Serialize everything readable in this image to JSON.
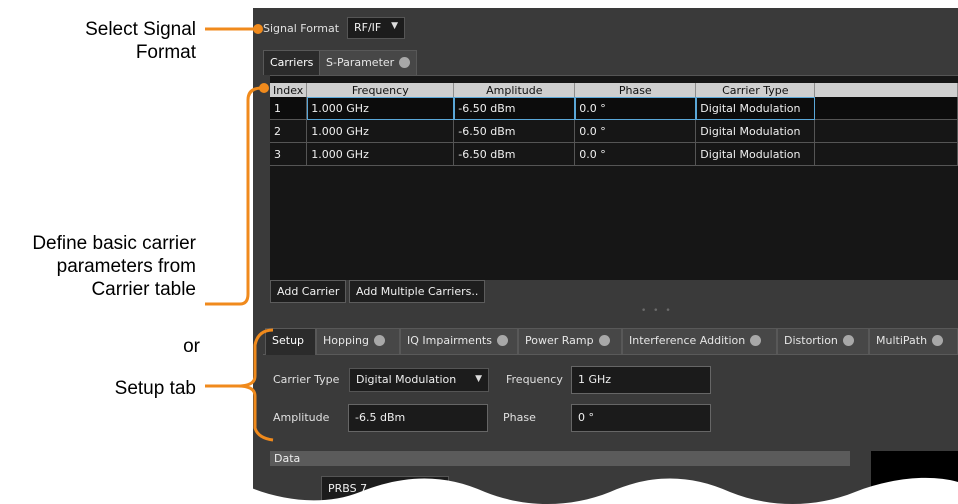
{
  "callouts": {
    "select_format": [
      "Select Signal",
      "Format"
    ],
    "define": [
      "Define basic carrier",
      "parameters from",
      "Carrier table"
    ],
    "or": "or",
    "setup": "Setup tab"
  },
  "signal_format": {
    "label": "Signal Format",
    "value": "RF/IF"
  },
  "top_tabs": [
    {
      "label": "Carriers"
    },
    {
      "label": "S-Parameter"
    }
  ],
  "carrier_table": {
    "columns": [
      "Index",
      "Frequency",
      "Amplitude",
      "Phase",
      "Carrier Type"
    ],
    "rows": [
      [
        "1",
        "1.000 GHz",
        "-6.50 dBm",
        "0.0 °",
        "Digital Modulation"
      ],
      [
        "2",
        "1.000 GHz",
        "-6.50 dBm",
        "0.0 °",
        "Digital Modulation"
      ],
      [
        "3",
        "1.000 GHz",
        "-6.50 dBm",
        "0.0 °",
        "Digital Modulation"
      ]
    ]
  },
  "buttons": {
    "add_carrier": "Add Carrier",
    "add_multiple": "Add Multiple Carriers.."
  },
  "setup_tabs": [
    {
      "label": "Setup"
    },
    {
      "label": "Hopping"
    },
    {
      "label": "IQ Impairments"
    },
    {
      "label": "Power Ramp"
    },
    {
      "label": "Interference Addition"
    },
    {
      "label": "Distortion"
    },
    {
      "label": "MultiPath"
    }
  ],
  "setup": {
    "carrier_type_label": "Carrier Type",
    "carrier_type_value": "Digital Modulation",
    "frequency_label": "Frequency",
    "frequency_value": "1 GHz",
    "amplitude_label": "Amplitude",
    "amplitude_value": "-6.5 dBm",
    "phase_label": "Phase",
    "phase_value": "0 °"
  },
  "data_section": {
    "label": "Data",
    "value": "PRBS 7"
  },
  "colors": {
    "accent": "#f08a1c",
    "selection": "#5aa7d8",
    "panel": "#3a3a3a"
  }
}
